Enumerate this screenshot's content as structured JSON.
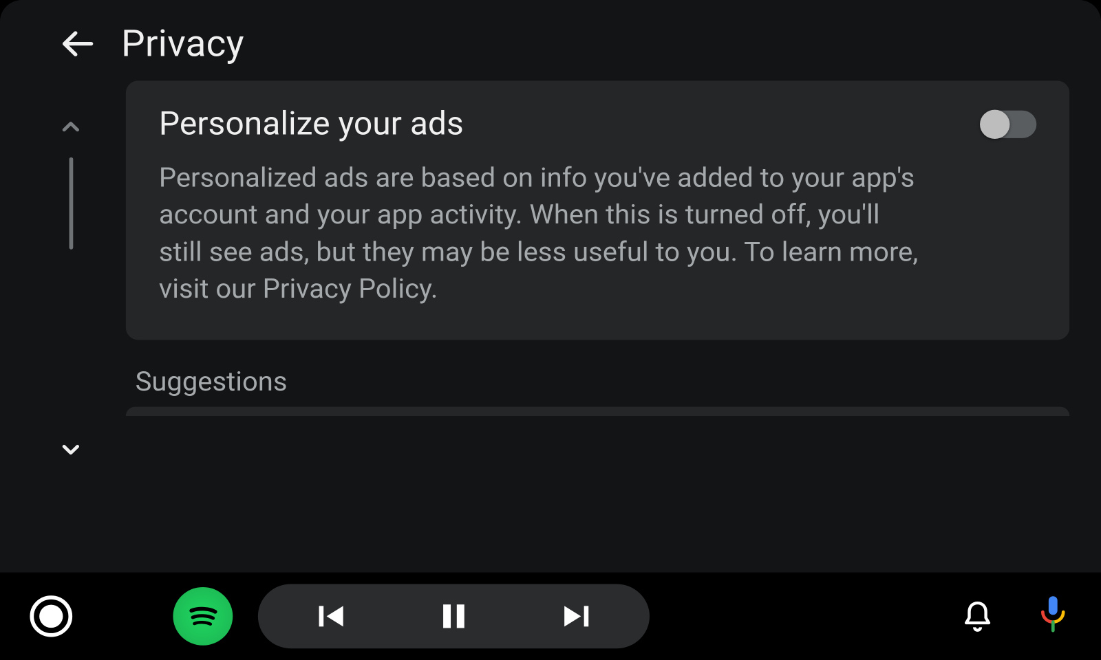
{
  "header": {
    "title": "Privacy"
  },
  "settings": {
    "personalize_ads": {
      "title": "Personalize your ads",
      "description": "Personalized ads are based on info you've added to your app's account and your app activity. When this is turned off, you'll still see ads, but they may be less useful to you. To learn more, visit our Privacy Policy.",
      "enabled": false
    }
  },
  "sections": {
    "suggestions_label": "Suggestions"
  },
  "media": {
    "app": "Spotify",
    "playing": true
  }
}
